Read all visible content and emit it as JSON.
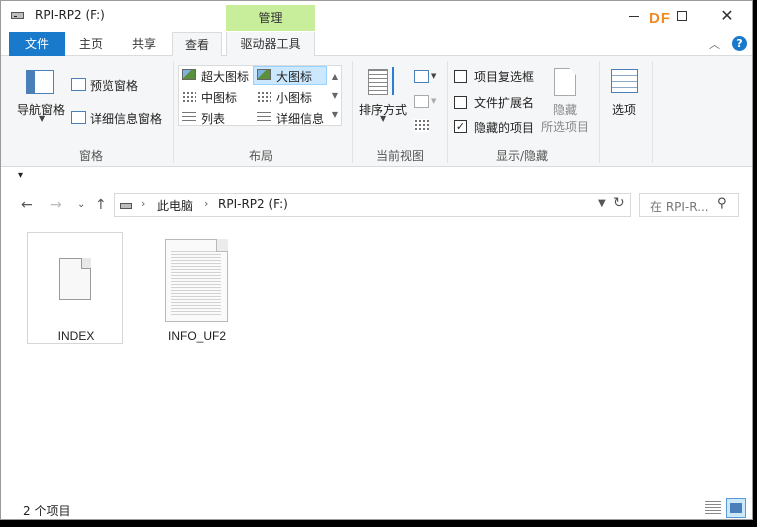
{
  "window": {
    "title": "RPI-RP2 (F:)"
  },
  "brand": {
    "logo_text": "DF",
    "logo_color": "#f08a24"
  },
  "ribbon": {
    "context_header": "管理",
    "file_tab": "文件",
    "tabs": [
      "主页",
      "共享",
      "查看",
      "驱动器工具"
    ],
    "active_tab": "查看",
    "panes": {
      "nav_pane": "导航窗格",
      "preview_pane": "预览窗格",
      "details_pane": "详细信息窗格",
      "label": "窗格"
    },
    "layout": {
      "extra_large": "超大图标",
      "large": "大图标",
      "medium": "中图标",
      "small": "小图标",
      "list": "列表",
      "details": "详细信息",
      "label": "布局"
    },
    "current_view": {
      "sort_by": "排序方式",
      "label": "当前视图"
    },
    "show_hide": {
      "item_checkboxes": "项目复选框",
      "item_checkboxes_checked": false,
      "file_extensions": "文件扩展名",
      "file_extensions_checked": false,
      "hidden_items": "隐藏的项目",
      "hidden_items_checked": true,
      "hide_selected_1": "隐藏",
      "hide_selected_2": "所选项目",
      "label": "显示/隐藏"
    },
    "options": "选项",
    "accent_color": "#1979ca",
    "context_color": "#c9ee9b"
  },
  "address": {
    "breadcrumb": [
      "此电脑",
      "RPI-RP2 (F:)"
    ],
    "search_placeholder": "在 RPI-R... "
  },
  "files": [
    {
      "name": "INDEX",
      "type": "blank-file-icon"
    },
    {
      "name": "INFO_UF2",
      "type": "text-file-icon"
    }
  ],
  "status": {
    "item_count": "2 个项目"
  }
}
